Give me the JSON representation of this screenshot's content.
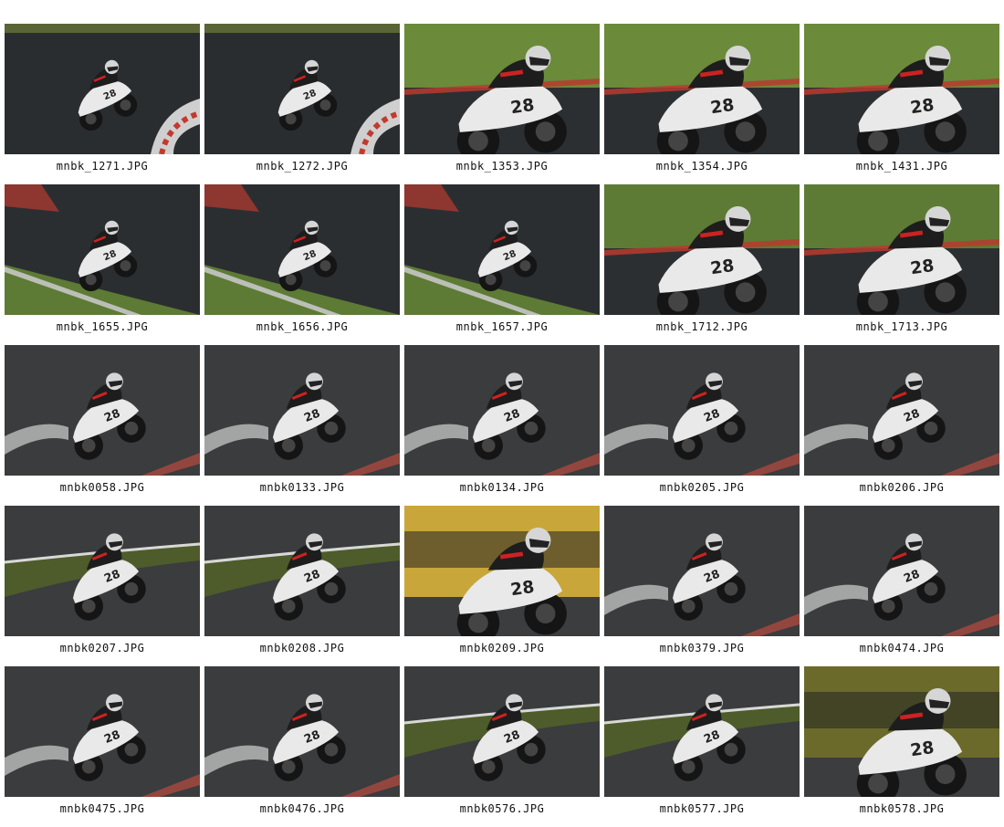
{
  "gallery": {
    "items": [
      {
        "filename": "mnbk_1271.JPG",
        "scene": "track-far",
        "bike_number": "28",
        "bg": "#2a2d30",
        "accent": "#7a8a3a"
      },
      {
        "filename": "mnbk_1272.JPG",
        "scene": "track-far",
        "bike_number": "28",
        "bg": "#2a2d30",
        "accent": "#7a8a3a"
      },
      {
        "filename": "mnbk_1353.JPG",
        "scene": "close-sponsor",
        "bike_number": "28",
        "bg": "#3e5a2a",
        "accent": "#6b8a3a"
      },
      {
        "filename": "mnbk_1354.JPG",
        "scene": "close-sponsor",
        "bike_number": "28",
        "bg": "#3e5a2a",
        "accent": "#6b8a3a"
      },
      {
        "filename": "mnbk_1431.JPG",
        "scene": "close-sponsor",
        "bike_number": "28",
        "bg": "#3e5a2a",
        "accent": "#6b8a3a"
      },
      {
        "filename": "mnbk_1655.JPG",
        "scene": "two-riders",
        "bike_number": "28",
        "bg": "#2b2e31",
        "accent": "#5d7b34"
      },
      {
        "filename": "mnbk_1656.JPG",
        "scene": "two-riders",
        "bike_number": "28",
        "bg": "#2b2e31",
        "accent": "#5d7b34"
      },
      {
        "filename": "mnbk_1657.JPG",
        "scene": "two-riders",
        "bike_number": "28",
        "bg": "#2b2e31",
        "accent": "#5d7b34"
      },
      {
        "filename": "mnbk_1712.JPG",
        "scene": "close-sponsor",
        "bike_number": "28",
        "bg": "#3a4a2a",
        "accent": "#5d7b34"
      },
      {
        "filename": "mnbk_1713.JPG",
        "scene": "close-sponsor",
        "bike_number": "28",
        "bg": "#3a4a2a",
        "accent": "#5d7b34"
      },
      {
        "filename": "mnbk0058.JPG",
        "scene": "lean-dark",
        "bike_number": "28",
        "bg": "#3a3c3e",
        "accent": "#4a4c4e"
      },
      {
        "filename": "mnbk0133.JPG",
        "scene": "lean-dark",
        "bike_number": "28",
        "bg": "#3a3c3e",
        "accent": "#4a4c4e"
      },
      {
        "filename": "mnbk0134.JPG",
        "scene": "lean-dark",
        "bike_number": "28",
        "bg": "#3a3c3e",
        "accent": "#4a4c4e"
      },
      {
        "filename": "mnbk0205.JPG",
        "scene": "lean-dark",
        "bike_number": "28",
        "bg": "#3a3c3e",
        "accent": "#4a4c4e"
      },
      {
        "filename": "mnbk0206.JPG",
        "scene": "lean-dark",
        "bike_number": "28",
        "bg": "#3a3c3e",
        "accent": "#4a4c4e"
      },
      {
        "filename": "mnbk0207.JPG",
        "scene": "lean-grass",
        "bike_number": "28",
        "bg": "#3a3c3e",
        "accent": "#4d5c2a"
      },
      {
        "filename": "mnbk0208.JPG",
        "scene": "lean-grass",
        "bike_number": "28",
        "bg": "#3a3c3e",
        "accent": "#4d5c2a"
      },
      {
        "filename": "mnbk0209.JPG",
        "scene": "lean-yellow",
        "bike_number": "28",
        "bg": "#2a2a22",
        "accent": "#c9a63a"
      },
      {
        "filename": "mnbk0379.JPG",
        "scene": "lean-dark",
        "bike_number": "28",
        "bg": "#3a3c3e",
        "accent": "#4a4c4e"
      },
      {
        "filename": "mnbk0474.JPG",
        "scene": "lean-dark",
        "bike_number": "28",
        "bg": "#3a3c3e",
        "accent": "#4a4c4e"
      },
      {
        "filename": "mnbk0475.JPG",
        "scene": "lean-dark",
        "bike_number": "28",
        "bg": "#3a3c3e",
        "accent": "#4a4c4e"
      },
      {
        "filename": "mnbk0476.JPG",
        "scene": "lean-dark",
        "bike_number": "28",
        "bg": "#3a3c3e",
        "accent": "#4a4c4e"
      },
      {
        "filename": "mnbk0576.JPG",
        "scene": "lean-grass",
        "bike_number": "28",
        "bg": "#3a3c3e",
        "accent": "#4d5c2a"
      },
      {
        "filename": "mnbk0577.JPG",
        "scene": "lean-grass",
        "bike_number": "28",
        "bg": "#3a3c3e",
        "accent": "#4d5c2a"
      },
      {
        "filename": "mnbk0578.JPG",
        "scene": "lean-yellow",
        "bike_number": "28",
        "bg": "#3a3c3e",
        "accent": "#6b6a2a"
      }
    ]
  }
}
